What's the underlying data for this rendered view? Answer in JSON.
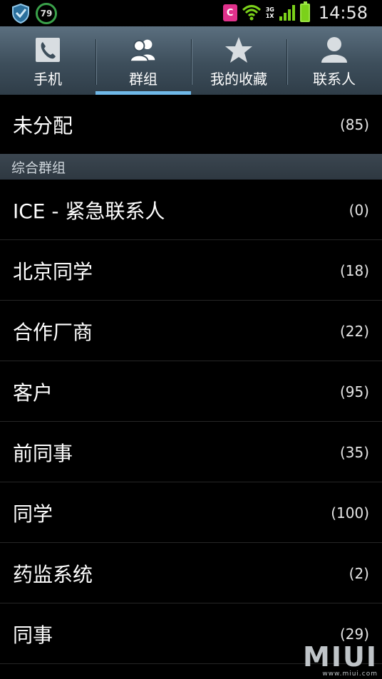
{
  "status_bar": {
    "battery_percent_badge": "79",
    "network_type_top": "3G",
    "network_type_bottom": "1X",
    "app_icon_letter": "C",
    "time": "14:58",
    "icons": [
      "shield-icon",
      "battery-circle-icon",
      "app-notification-icon",
      "wifi-icon",
      "signal-icon",
      "battery-icon"
    ]
  },
  "tabs": [
    {
      "label": "手机",
      "icon": "phone-icon",
      "active": false
    },
    {
      "label": "群组",
      "icon": "group-icon",
      "active": true
    },
    {
      "label": "我的收藏",
      "icon": "star-icon",
      "active": false
    },
    {
      "label": "联系人",
      "icon": "person-icon",
      "active": false
    }
  ],
  "unassigned": {
    "name": "未分配",
    "count": "(85)"
  },
  "section_header": "综合群组",
  "groups": [
    {
      "name": "ICE - 紧急联系人",
      "count": "(0)"
    },
    {
      "name": "北京同学",
      "count": "(18)"
    },
    {
      "name": "合作厂商",
      "count": "(22)"
    },
    {
      "name": "客户",
      "count": "(95)"
    },
    {
      "name": "前同事",
      "count": "(35)"
    },
    {
      "name": "同学",
      "count": "(100)"
    },
    {
      "name": "药监系统",
      "count": "(2)"
    },
    {
      "name": "同事",
      "count": "(29)"
    }
  ],
  "watermark": {
    "brand": "MIUI",
    "url": "www.miui.com"
  },
  "colors": {
    "accent": "#6fb8e8",
    "tabbar": "#3d4e5b",
    "battery": "#7bd11a",
    "section": "#2e3841"
  }
}
